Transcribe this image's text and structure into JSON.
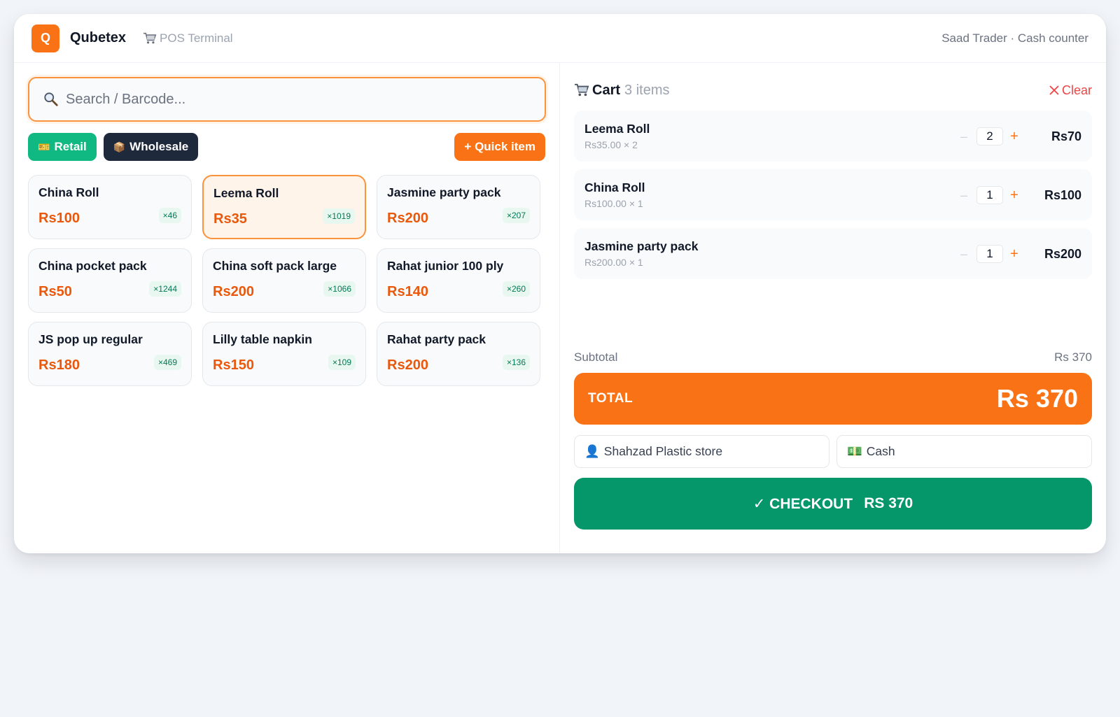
{
  "header": {
    "logo_letter": "Q",
    "brand": "Qubetex",
    "terminal": "POS Terminal",
    "store": "Saad Trader · Cash counter"
  },
  "search": {
    "placeholder": "Search / Barcode..."
  },
  "modes": {
    "retail": "Retail",
    "wholesale": "Wholesale",
    "quick_item": "+ Quick item"
  },
  "products": [
    {
      "name": "China Roll",
      "price": "Rs100",
      "stock": "×46",
      "selected": false
    },
    {
      "name": "Leema Roll",
      "price": "Rs35",
      "stock": "×1019",
      "selected": true
    },
    {
      "name": "Jasmine party pack",
      "price": "Rs200",
      "stock": "×207",
      "selected": false
    },
    {
      "name": "China pocket pack",
      "price": "Rs50",
      "stock": "×1244",
      "selected": false
    },
    {
      "name": "China soft pack large",
      "price": "Rs200",
      "stock": "×1066",
      "selected": false
    },
    {
      "name": "Rahat junior 100 ply",
      "price": "Rs140",
      "stock": "×260",
      "selected": false
    },
    {
      "name": "JS pop up regular",
      "price": "Rs180",
      "stock": "×469",
      "selected": false
    },
    {
      "name": "Lilly table napkin",
      "price": "Rs150",
      "stock": "×109",
      "selected": false
    },
    {
      "name": "Rahat party pack",
      "price": "Rs200",
      "stock": "×136",
      "selected": false
    }
  ],
  "cart": {
    "title": "Cart",
    "count": "3 items",
    "clear": "Clear",
    "items": [
      {
        "name": "Leema Roll",
        "meta": "Rs35.00 × 2",
        "qty": "2",
        "line_total": "Rs70",
        "minus": "–",
        "plus": "+"
      },
      {
        "name": "China Roll",
        "meta": "Rs100.00 × 1",
        "qty": "1",
        "line_total": "Rs100",
        "minus": "–",
        "plus": "+"
      },
      {
        "name": "Jasmine party pack",
        "meta": "Rs200.00 × 1",
        "qty": "1",
        "line_total": "Rs200",
        "minus": "–",
        "plus": "+"
      }
    ],
    "subtotal_label": "Subtotal",
    "subtotal_value": "Rs 370",
    "total_label": "TOTAL",
    "total_value": "Rs 370",
    "customer": "Shahzad Plastic store",
    "payment": "Cash",
    "checkout_label": "✓ CHECKOUT",
    "checkout_amount": "RS 370"
  },
  "colors": {
    "accent": "#f97316",
    "success": "#059669",
    "retail": "#10b981",
    "wholesale": "#1e293b",
    "danger": "#ef4444"
  },
  "icons": {
    "search": "magnifier-icon",
    "cart": "cart-icon",
    "retail": "tag-icon",
    "wholesale": "package-icon",
    "customer": "user-icon",
    "payment": "cash-icon"
  }
}
